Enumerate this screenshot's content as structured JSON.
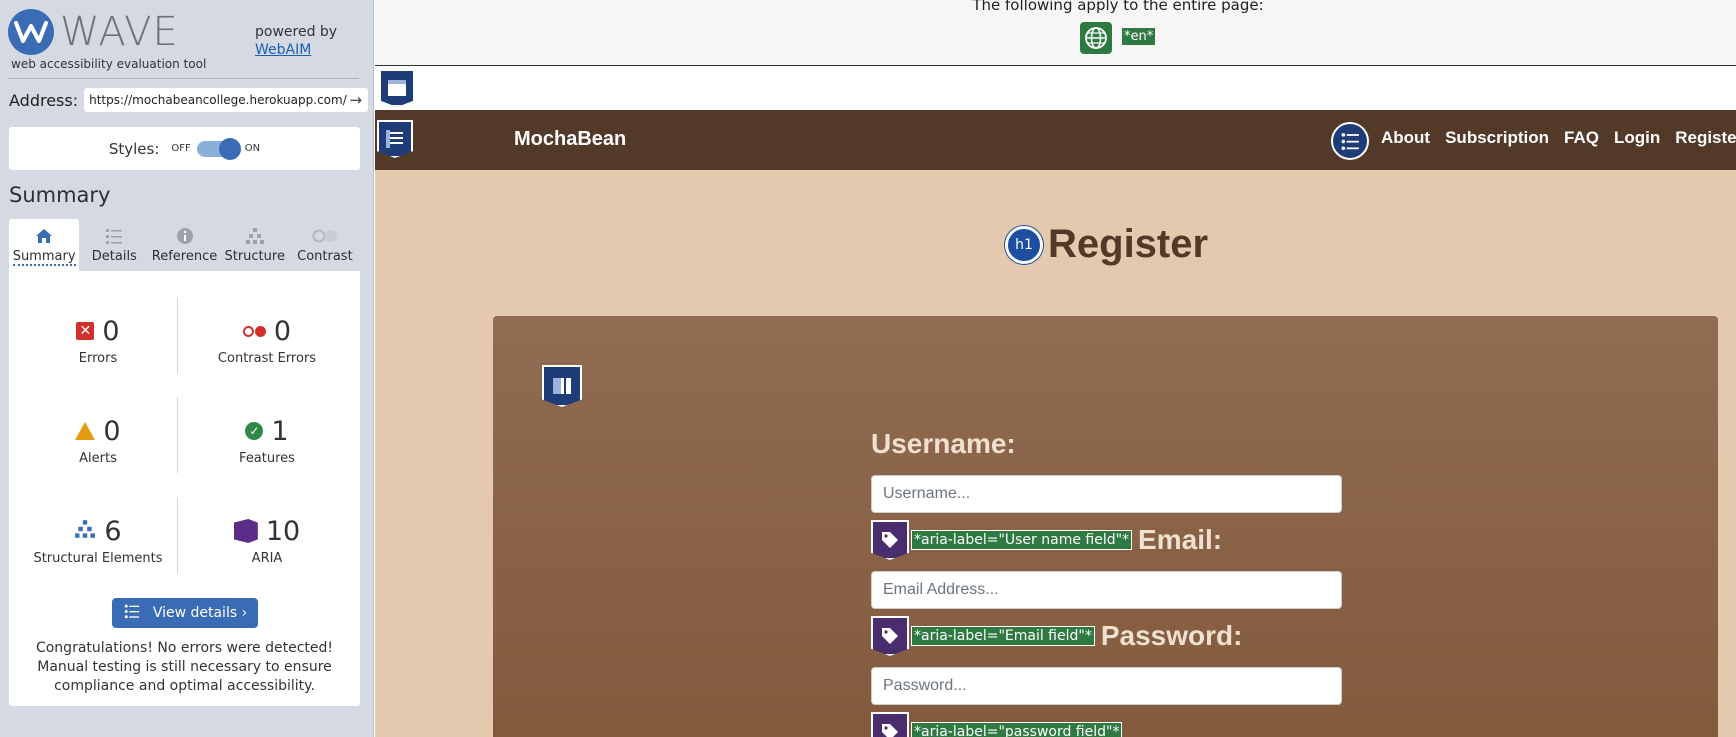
{
  "wave": {
    "logo_text": "WAVE",
    "logo_sub": "web accessibility evaluation tool",
    "powered_by": "powered by",
    "webaim_link": "WebAIM",
    "address_label": "Address:",
    "address_value": "https://mochabeancollege.herokuapp.com/",
    "styles_label": "Styles:",
    "styles_off": "OFF",
    "styles_on": "ON",
    "styles_enabled": true,
    "summary_heading": "Summary",
    "tabs": [
      {
        "label": "Summary",
        "icon": "home-icon",
        "active": true
      },
      {
        "label": "Details",
        "icon": "list-icon",
        "active": false
      },
      {
        "label": "Reference",
        "icon": "info-icon",
        "active": false
      },
      {
        "label": "Structure",
        "icon": "hierarchy-icon",
        "active": false
      },
      {
        "label": "Contrast",
        "icon": "contrast-icon",
        "active": false
      }
    ],
    "stats": {
      "errors": {
        "value": "0",
        "label": "Errors"
      },
      "contrast_errors": {
        "value": "0",
        "label": "Contrast Errors"
      },
      "alerts": {
        "value": "0",
        "label": "Alerts"
      },
      "features": {
        "value": "1",
        "label": "Features"
      },
      "structural": {
        "value": "6",
        "label": "Structural Elements"
      },
      "aria": {
        "value": "10",
        "label": "ARIA"
      }
    },
    "view_details": "View details ›",
    "congrats": "Congratulations! No errors were detected! Manual testing is still necessary to ensure compliance and optimal accessibility."
  },
  "page": {
    "applies_text": "The following apply to the entire page:",
    "lang_tag": "*en*",
    "brand": "MochaBean",
    "nav": [
      "About",
      "Subscription",
      "FAQ",
      "Login",
      "Register"
    ],
    "h1_badge": "h1",
    "heading": "Register",
    "fields": [
      {
        "label": "Username:",
        "placeholder": "Username...",
        "aria": "*aria-label=\"User name field\"*"
      },
      {
        "label": "Email:",
        "placeholder": "Email Address...",
        "aria": "*aria-label=\"Email field\"*"
      },
      {
        "label": "Password:",
        "placeholder": "Password...",
        "aria": "*aria-label=\"password field\"*"
      }
    ]
  },
  "colors": {
    "wave_blue": "#3a6cb5",
    "navbar_brown": "#533927",
    "content_bg": "#e4c9ae",
    "card_brown": "#8a6246",
    "aria_green": "#2f7a42",
    "aria_purple": "#4a2d6e"
  }
}
